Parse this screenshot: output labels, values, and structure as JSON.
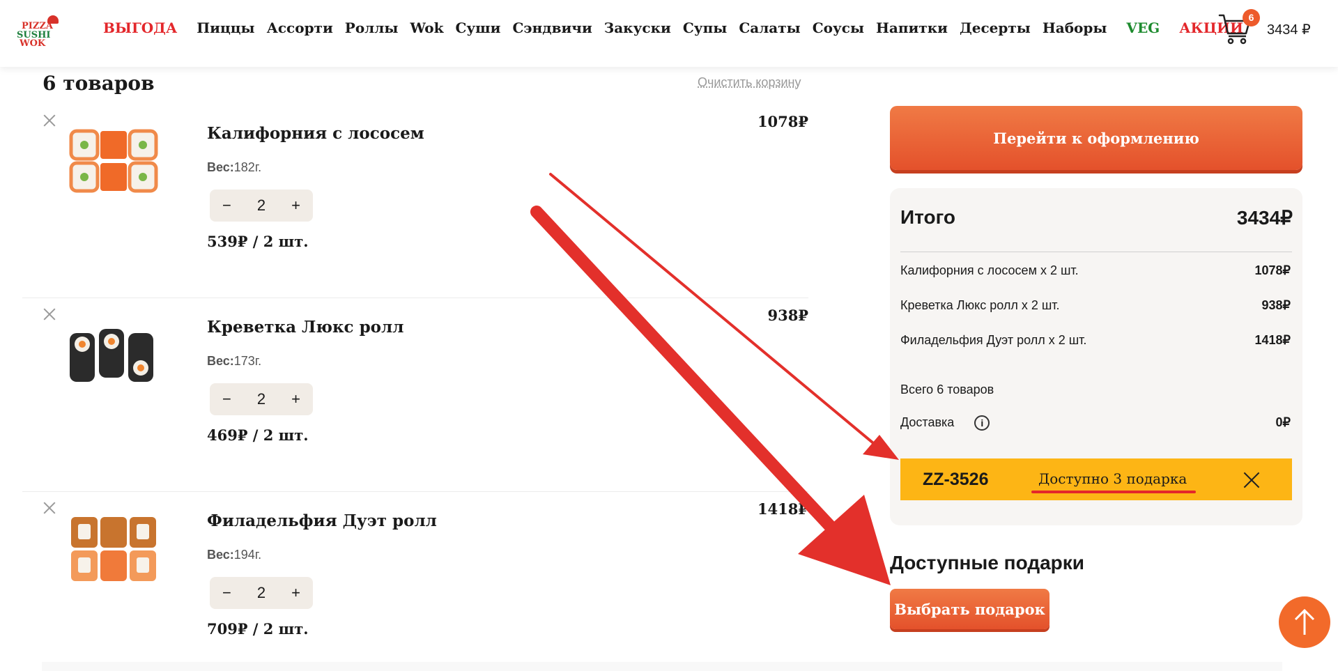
{
  "header": {
    "logo_text": [
      "PIZZA",
      "SUSHI",
      "WOK"
    ],
    "nav": [
      {
        "label": "ВЫГОДА",
        "style": "red"
      },
      {
        "label": "Пиццы"
      },
      {
        "label": "Ассорти"
      },
      {
        "label": "Роллы"
      },
      {
        "label": "Wok"
      },
      {
        "label": "Суши"
      },
      {
        "label": "Сэндвичи"
      },
      {
        "label": "Закуски"
      },
      {
        "label": "Супы"
      },
      {
        "label": "Салаты"
      },
      {
        "label": "Соусы"
      },
      {
        "label": "Напитки"
      },
      {
        "label": "Десерты"
      },
      {
        "label": "Наборы"
      },
      {
        "label": "VEG",
        "style": "green"
      },
      {
        "label": "АКЦИИ",
        "style": "red"
      }
    ],
    "cart_count": "6",
    "cart_total": "3434 ₽"
  },
  "cart": {
    "count_title": "6 товаров",
    "clear_label": "Очистить корзину",
    "items": [
      {
        "name": "Калифорния с лососем",
        "weight_label": "Вес:",
        "weight": "182г.",
        "qty": "2",
        "unit_price": "539₽ / 2 шт.",
        "price": "1078₽",
        "image": "california-roll"
      },
      {
        "name": "Креветка Люкс ролл",
        "weight_label": "Вес:",
        "weight": "173г.",
        "qty": "2",
        "unit_price": "469₽ / 2 шт.",
        "price": "938₽",
        "image": "shrimp-roll"
      },
      {
        "name": "Филадельфия Дуэт ролл",
        "weight_label": "Вес:",
        "weight": "194г.",
        "qty": "2",
        "unit_price": "709₽ / 2 шт.",
        "price": "1418₽",
        "image": "philadelphia-roll"
      }
    ],
    "minus": "−",
    "plus": "+"
  },
  "summary": {
    "checkout_label": "Перейти к оформлению",
    "total_label": "Итого",
    "total_value": "3434₽",
    "lines": [
      {
        "label": "Калифорния с лососем x 2 шт.",
        "value": "1078₽"
      },
      {
        "label": "Креветка Люкс ролл x 2 шт.",
        "value": "938₽"
      },
      {
        "label": "Филадельфия Дуэт ролл x 2 шт.",
        "value": "1418₽"
      }
    ],
    "items_total": "Всего 6 товаров",
    "delivery_label": "Доставка",
    "delivery_value": "0₽",
    "info_icon": "i",
    "promo_code": "ZZ-3526",
    "promo_text": "Доступно 3 подарка"
  },
  "gifts": {
    "title": "Доступные подарки",
    "button": "Выбрать подарок"
  },
  "colors": {
    "accent": "#e4512b",
    "promo": "#fdb515",
    "red": "#e3272b",
    "green": "#1e8b2f"
  }
}
